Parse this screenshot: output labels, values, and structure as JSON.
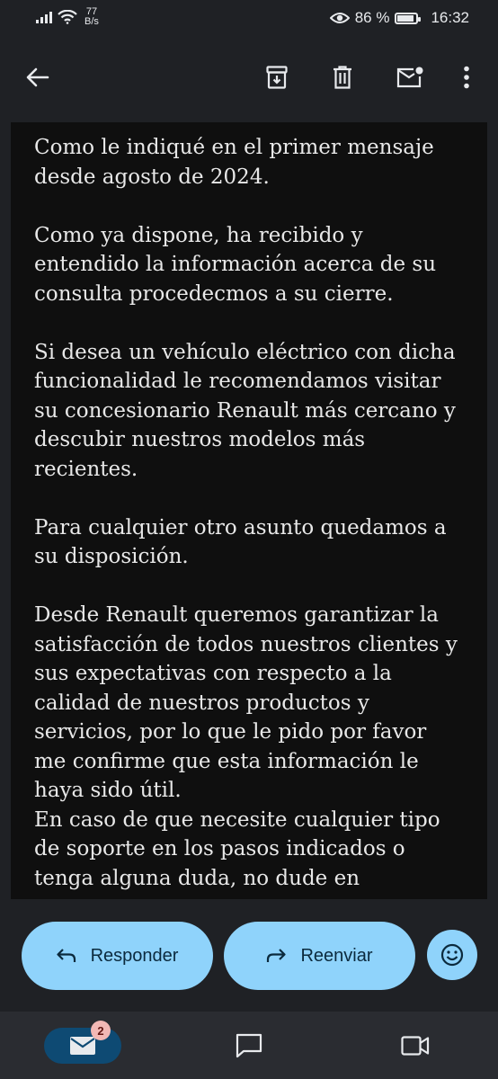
{
  "status_bar": {
    "speed_value": "77",
    "speed_unit": "B/s",
    "battery": "86 %",
    "battery_level": 0.86,
    "time": "16:32"
  },
  "toolbar": {
    "icons": [
      "back-arrow-icon",
      "archive-icon",
      "delete-icon",
      "mark-unread-icon",
      "more-vert-icon"
    ]
  },
  "message": {
    "paragraphs": [
      "Como le indiqué en el primer mensaje desde agosto de 2024.",
      "Como ya dispone, ha recibido y entendido la información acerca de su consulta procedecmos a su cierre.",
      "Si desea un vehículo eléctrico con dicha funcionalidad le recomendamos visitar su concesionario Renault más cercano y descubir nuestros modelos más recientes.",
      "Para cualquier otro asunto quedamos a su disposición.",
      "Desde Renault queremos garantizar la satisfacción de todos nuestros clientes y sus expectativas con respecto a la calidad de nuestros productos y servicios, por lo que le pido por favor me confirme que esta información le haya sido útil.",
      "En caso de que necesite cualquier tipo de soporte en los pasos indicados o tenga alguna duda, no dude en"
    ]
  },
  "actions": {
    "reply_label": "Responder",
    "forward_label": "Reenviar"
  },
  "bottom_nav": {
    "mail_badge": "2"
  },
  "colors": {
    "background": "#1f2125",
    "message_bg": "#0f0f0f",
    "accent": "#8fd3fb",
    "nav_selected": "#0e4a73",
    "badge": "#f2b8b5"
  }
}
